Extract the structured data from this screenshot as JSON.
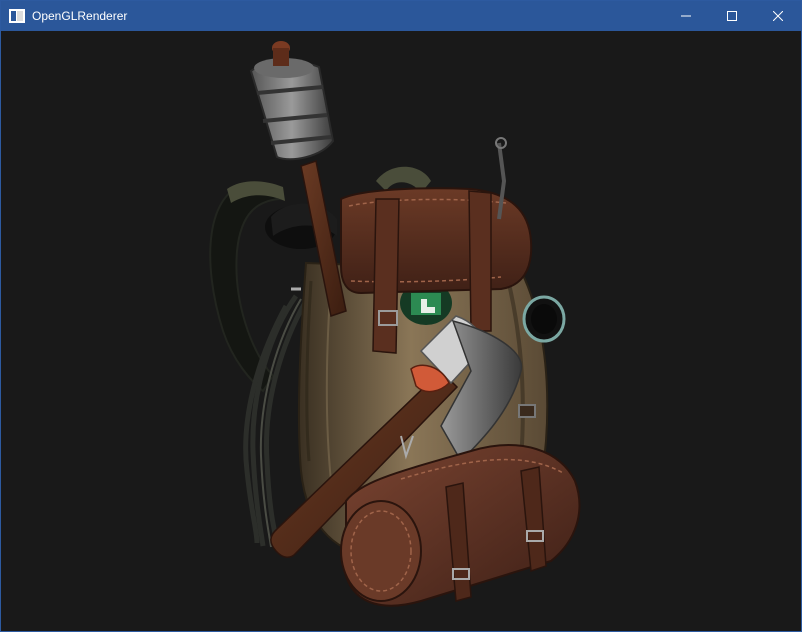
{
  "window": {
    "title": "OpenGLRenderer",
    "title_bar_color": "#2b579a",
    "controls": {
      "minimize_icon": "minimize-icon",
      "maximize_icon": "maximize-icon",
      "close_icon": "close-icon"
    }
  },
  "viewport": {
    "background_color": "#191919",
    "scene_object": "backpack-3d-model"
  }
}
